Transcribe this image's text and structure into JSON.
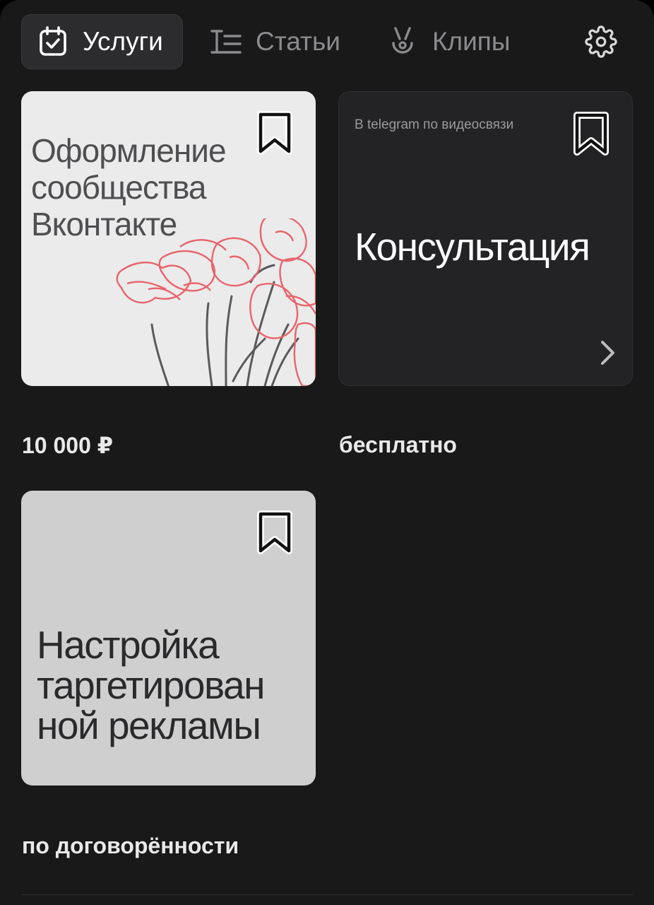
{
  "tabs": [
    {
      "label": "Услуги",
      "icon": "calendar-check-icon",
      "active": true
    },
    {
      "label": "Статьи",
      "icon": "text-lines-icon",
      "active": false
    },
    {
      "label": "Клипы",
      "icon": "clips-icon",
      "active": false
    }
  ],
  "settings_icon": "gear-icon",
  "cards": [
    {
      "title": "Оформление сообщества Вконтакте",
      "price": "10 000 ₽",
      "bookmark_icon": "bookmark-icon"
    },
    {
      "subtitle": "В telegram по видеосвязи",
      "title": "Консультация",
      "price": "бесплатно",
      "bookmark_icon": "bookmark-icon",
      "chevron_icon": "chevron-right-icon"
    },
    {
      "title": "Настройка таргетирован ной рекламы",
      "price": "по договорённости",
      "bookmark_icon": "bookmark-icon"
    }
  ],
  "colors": {
    "background": "#19191a",
    "active_tab": "#2c2c2e",
    "inactive_text": "#8b8b8e",
    "flower_red": "#e8646c",
    "stem_gray": "#5a5a5c"
  }
}
